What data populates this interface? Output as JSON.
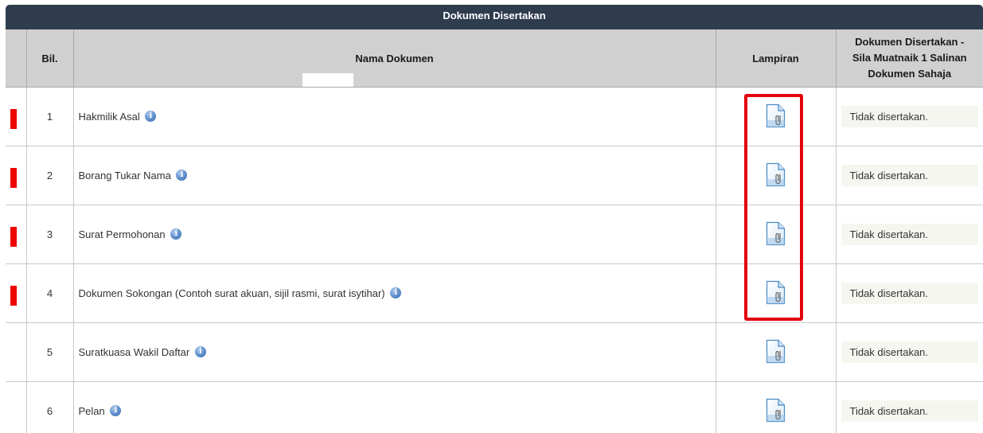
{
  "section": {
    "title": "Dokumen Disertakan"
  },
  "table": {
    "headers": {
      "num": "Bil.",
      "name": "Nama Dokumen",
      "attachment": "Lampiran",
      "status_line1": "Dokumen Disertakan -",
      "status_line2": "Sila Muatnaik 1 Salinan",
      "status_line3": "Dokumen Sahaja"
    },
    "rows": [
      {
        "num": "1",
        "name": "Hakmilik Asal",
        "required": true,
        "status": "Tidak disertakan.",
        "info_icon": "info-icon",
        "attachment_icon": "file-attachment-icon"
      },
      {
        "num": "2",
        "name": "Borang Tukar Nama",
        "required": true,
        "status": "Tidak disertakan.",
        "info_icon": "info-icon",
        "attachment_icon": "file-attachment-icon"
      },
      {
        "num": "3",
        "name": "Surat Permohonan",
        "required": true,
        "status": "Tidak disertakan.",
        "info_icon": "info-icon",
        "attachment_icon": "file-attachment-icon"
      },
      {
        "num": "4",
        "name": "Dokumen Sokongan (Contoh surat akuan, sijil rasmi, surat isytihar)",
        "required": true,
        "status": "Tidak disertakan.",
        "info_icon": "info-icon",
        "attachment_icon": "file-attachment-icon"
      },
      {
        "num": "5",
        "name": "Suratkuasa Wakil Daftar",
        "required": false,
        "status": "Tidak disertakan.",
        "info_icon": "info-icon",
        "attachment_icon": "file-attachment-icon"
      },
      {
        "num": "6",
        "name": "Pelan",
        "required": false,
        "status": "Tidak disertakan.",
        "info_icon": "info-icon",
        "attachment_icon": "file-attachment-icon"
      }
    ]
  },
  "colors": {
    "header_bar": "#2e3c4e",
    "column_header_bg": "#d0d0d0",
    "required_marker": "#ee0000",
    "highlight_border": "#e3000e",
    "status_box_bg": "#f6f6f1",
    "info_icon": "#5c8dca"
  }
}
